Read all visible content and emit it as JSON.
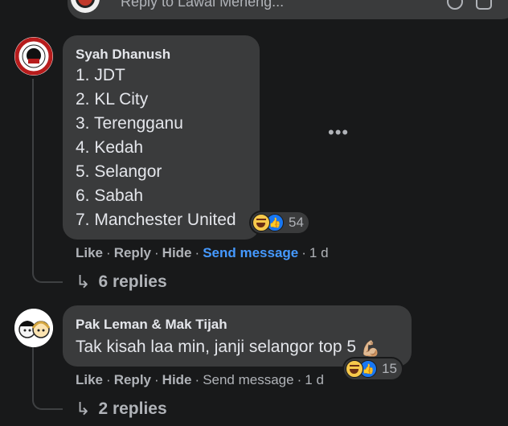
{
  "top_reply": {
    "placeholder": "Reply to Lawai Meneng..."
  },
  "comments": [
    {
      "author": "Syah Dhanush",
      "lines": [
        "1. JDT",
        "2. KL City",
        "3. Terengganu",
        "4. Kedah",
        "5. Selangor",
        "6. Sabah",
        "7. Manchester United"
      ],
      "reaction_count": "54",
      "actions": {
        "like": "Like",
        "reply": "Reply",
        "hide": "Hide",
        "send_message": "Send message",
        "time": "1 d"
      },
      "replies_label": "6 replies",
      "more_icon": "ellipsis-icon"
    },
    {
      "author": "Pak Leman & Mak Tijah",
      "text": "Tak kisah laa min, janji selangor top 5",
      "text_emoji": "💪🏼",
      "reaction_count": "15",
      "actions": {
        "like": "Like",
        "reply": "Reply",
        "hide": "Hide",
        "send_message": "Send message",
        "time": "1 d"
      },
      "replies_label": "2 replies"
    }
  ],
  "separator": "·",
  "reply_arrow": "↳",
  "colors": {
    "background": "#18191a",
    "bubble": "#3a3b3c",
    "text": "#e4e6eb",
    "muted": "#b0b3b8",
    "link_blue": "#4599ff",
    "like_blue": "#1877f2"
  }
}
